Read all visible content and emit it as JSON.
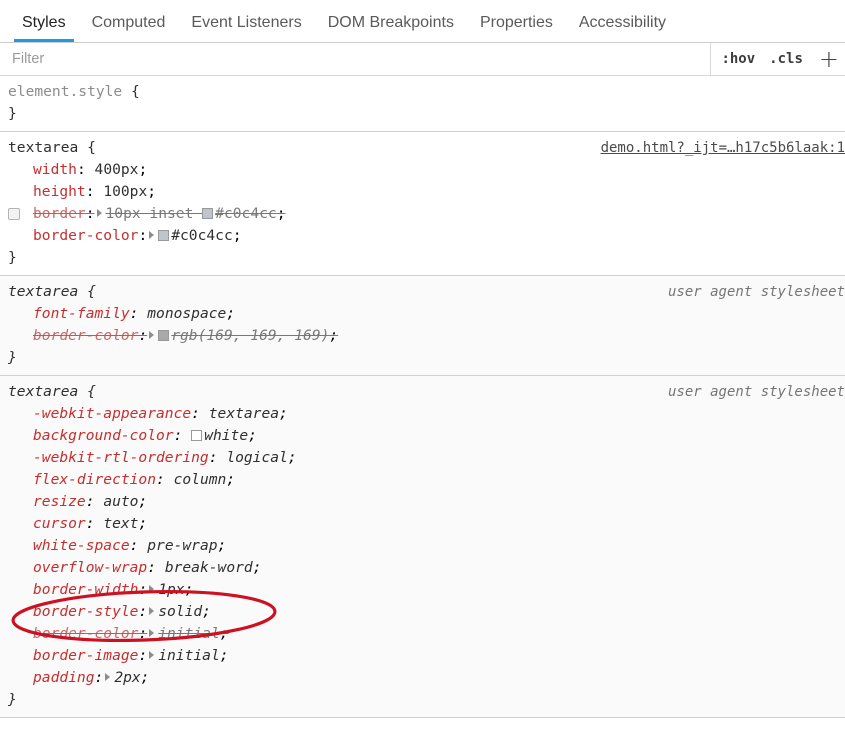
{
  "panel": {
    "tabs": [
      {
        "label": "Styles",
        "active": true
      },
      {
        "label": "Computed",
        "active": false
      },
      {
        "label": "Event Listeners",
        "active": false
      },
      {
        "label": "DOM Breakpoints",
        "active": false
      },
      {
        "label": "Properties",
        "active": false
      },
      {
        "label": "Accessibility",
        "active": false
      }
    ],
    "accent_color": "#1a9edb"
  },
  "filter": {
    "placeholder": "Filter",
    "value": "",
    "hov_label": ":hov",
    "cls_label": ".cls",
    "add_label": "+"
  },
  "rules": [
    {
      "selector": "element.style",
      "open_brace": "{",
      "close_brace": "}",
      "origin": "",
      "declarations": []
    },
    {
      "selector": "textarea",
      "open_brace": "{",
      "close_brace": "}",
      "origin": "demo.html?_ijt=…h17c5b6laak:1",
      "origin_kind": "link",
      "declarations": [
        {
          "name": "width",
          "value": "400px",
          "disabled": false,
          "expandable": false,
          "swatch": "",
          "checkbox": false
        },
        {
          "name": "height",
          "value": "100px",
          "disabled": false,
          "expandable": false,
          "swatch": "",
          "checkbox": false
        },
        {
          "name": "border",
          "value": "10px inset #c0c4cc",
          "disabled": true,
          "expandable": true,
          "swatch": "#c0c4cc",
          "checkbox": true
        },
        {
          "name": "border-color",
          "value": "#c0c4cc",
          "disabled": false,
          "expandable": true,
          "swatch": "#c0c4cc",
          "checkbox": false
        }
      ]
    },
    {
      "selector": "textarea",
      "open_brace": "{",
      "close_brace": "}",
      "origin": "user agent stylesheet",
      "origin_kind": "ua",
      "declarations": [
        {
          "name": "font-family",
          "value": "monospace",
          "disabled": false,
          "expandable": false,
          "swatch": "",
          "checkbox": false
        },
        {
          "name": "border-color",
          "value": "rgb(169, 169, 169)",
          "disabled": true,
          "expandable": true,
          "swatch": "#a9a9a9",
          "checkbox": false
        }
      ]
    },
    {
      "selector": "textarea",
      "open_brace": "{",
      "close_brace": "}",
      "origin": "user agent stylesheet",
      "origin_kind": "ua",
      "declarations": [
        {
          "name": "-webkit-appearance",
          "value": "textarea",
          "disabled": false,
          "expandable": false,
          "swatch": "",
          "checkbox": false
        },
        {
          "name": "background-color",
          "value": "white",
          "disabled": false,
          "expandable": false,
          "swatch": "#ffffff",
          "checkbox": false
        },
        {
          "name": "-webkit-rtl-ordering",
          "value": "logical",
          "disabled": false,
          "expandable": false,
          "swatch": "",
          "checkbox": false
        },
        {
          "name": "flex-direction",
          "value": "column",
          "disabled": false,
          "expandable": false,
          "swatch": "",
          "checkbox": false
        },
        {
          "name": "resize",
          "value": "auto",
          "disabled": false,
          "expandable": false,
          "swatch": "",
          "checkbox": false
        },
        {
          "name": "cursor",
          "value": "text",
          "disabled": false,
          "expandable": false,
          "swatch": "",
          "checkbox": false
        },
        {
          "name": "white-space",
          "value": "pre-wrap",
          "disabled": false,
          "expandable": false,
          "swatch": "",
          "checkbox": false
        },
        {
          "name": "overflow-wrap",
          "value": "break-word",
          "disabled": false,
          "expandable": false,
          "swatch": "",
          "checkbox": false
        },
        {
          "name": "border-width",
          "value": "1px",
          "disabled": false,
          "expandable": true,
          "swatch": "",
          "checkbox": false
        },
        {
          "name": "border-style",
          "value": "solid",
          "disabled": false,
          "expandable": true,
          "swatch": "",
          "checkbox": false
        },
        {
          "name": "border-color",
          "value": "initial",
          "disabled": true,
          "expandable": true,
          "swatch": "",
          "checkbox": false
        },
        {
          "name": "border-image",
          "value": "initial",
          "disabled": false,
          "expandable": true,
          "swatch": "",
          "checkbox": false
        },
        {
          "name": "padding",
          "value": "2px",
          "disabled": false,
          "expandable": true,
          "swatch": "",
          "checkbox": false
        }
      ]
    }
  ],
  "annotation": {
    "shape": "ellipse",
    "color": "#cc1122",
    "targets": [
      "border-width",
      "border-style"
    ]
  }
}
